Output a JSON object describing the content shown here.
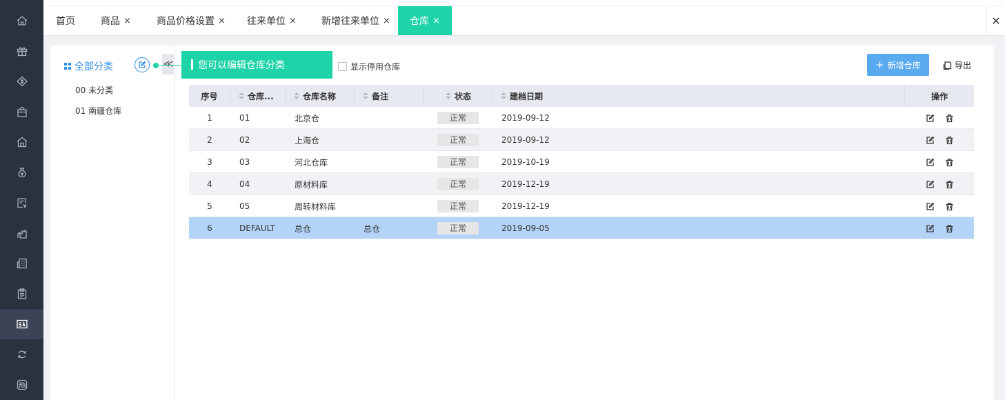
{
  "tabs": [
    {
      "label": "首页",
      "closable": false
    },
    {
      "label": "商品",
      "closable": true
    },
    {
      "label": "商品价格设置",
      "closable": true
    },
    {
      "label": "往来单位",
      "closable": true
    },
    {
      "label": "新增往来单位",
      "closable": true
    },
    {
      "label": "仓库",
      "closable": true,
      "active": true
    }
  ],
  "tab_close_glyph": "×",
  "close_all_glyph": "✕",
  "accent_color": "#1fd3a8",
  "primary_color": "#5aaaf0",
  "sidebar_icons": [
    "home-icon",
    "gift-icon",
    "tag-icon",
    "bag-icon",
    "store-icon",
    "money-bag-icon",
    "invoice-icon",
    "hand-coin-icon",
    "building-icon",
    "clipboard-icon",
    "id-card-icon",
    "refresh-icon",
    "new-icon"
  ],
  "tree": {
    "root": "全部分类",
    "items": [
      "00 未分类",
      "01 南疆仓库"
    ],
    "collapse_glyph": "≪"
  },
  "tooltip": "您可以编辑仓库分类",
  "toolbar": {
    "show_disabled": "显示停用仓库",
    "show_disabled_checked": false,
    "add_button": "新增仓库",
    "add_plus": "+",
    "export_button": "导出"
  },
  "table": {
    "columns": [
      "序号",
      "仓库...",
      "仓库名称",
      "备注",
      "状态",
      "建档日期",
      "操作"
    ],
    "rows": [
      {
        "index": "1",
        "code": "01",
        "name": "北京仓",
        "remark": "",
        "status": "正常",
        "date": "2019-09-12"
      },
      {
        "index": "2",
        "code": "02",
        "name": "上海仓",
        "remark": "",
        "status": "正常",
        "date": "2019-09-12"
      },
      {
        "index": "3",
        "code": "03",
        "name": "河北仓库",
        "remark": "",
        "status": "正常",
        "date": "2019-10-19"
      },
      {
        "index": "4",
        "code": "04",
        "name": "原材料库",
        "remark": "",
        "status": "正常",
        "date": "2019-12-19"
      },
      {
        "index": "5",
        "code": "05",
        "name": "周转材料库",
        "remark": "",
        "status": "正常",
        "date": "2019-12-19"
      },
      {
        "index": "6",
        "code": "DEFAULT",
        "name": "总仓",
        "remark": "总仓",
        "status": "正常",
        "date": "2019-09-05",
        "selected": true
      }
    ]
  }
}
